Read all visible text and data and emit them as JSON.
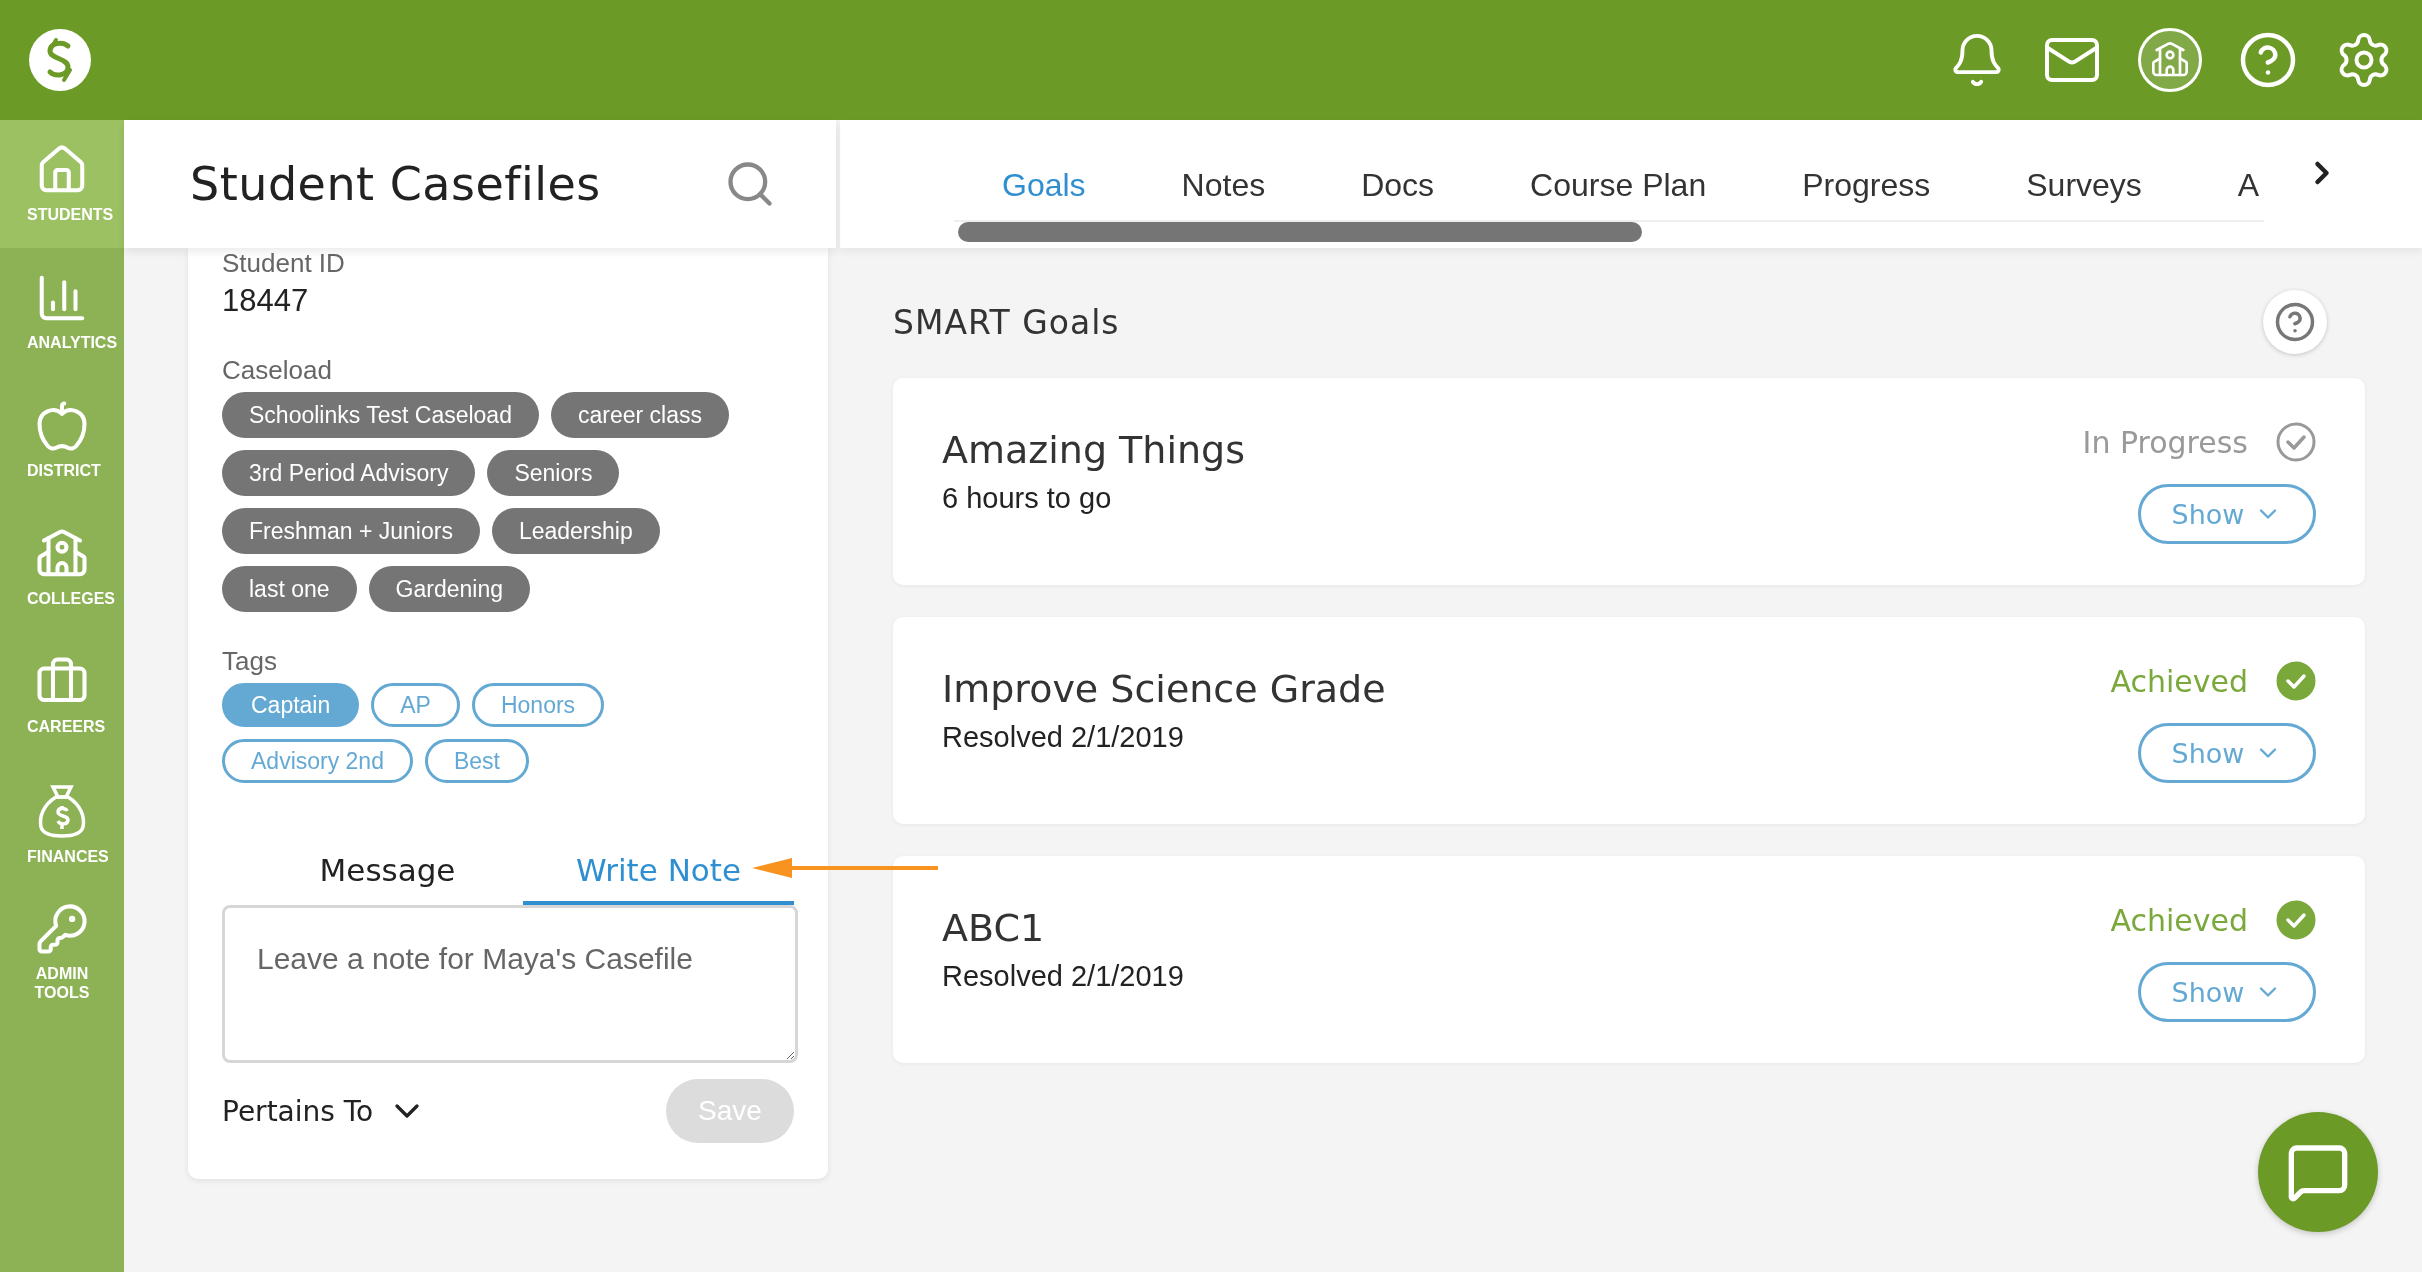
{
  "sidebar": {
    "items": [
      {
        "label": "STUDENTS",
        "selected": true
      },
      {
        "label": "ANALYTICS",
        "selected": false
      },
      {
        "label": "DISTRICT",
        "selected": false
      },
      {
        "label": "COLLEGES",
        "selected": false
      },
      {
        "label": "CAREERS",
        "selected": false
      },
      {
        "label": "FINANCES",
        "selected": false
      },
      {
        "label": "ADMIN TOOLS",
        "selected": false
      }
    ]
  },
  "casefile": {
    "title": "Student Casefiles",
    "student_id_label": "Student ID",
    "student_id": "18447",
    "caseload_label": "Caseload",
    "caseload": [
      "Schoolinks Test Caseload",
      "career class",
      "3rd Period Advisory",
      "Seniors",
      "Freshman + Juniors",
      "Leadership",
      "last one",
      "Gardening"
    ],
    "tags_label": "Tags",
    "tags": [
      {
        "label": "Captain",
        "selected": true
      },
      {
        "label": "AP",
        "selected": false
      },
      {
        "label": "Honors",
        "selected": false
      },
      {
        "label": "Advisory 2nd",
        "selected": false
      },
      {
        "label": "Best",
        "selected": false
      }
    ],
    "note_tabs": [
      {
        "label": "Message",
        "selected": false
      },
      {
        "label": "Write Note",
        "selected": true
      }
    ],
    "note": {
      "placeholder": "Leave a note for Maya's Casefile"
    },
    "pertains_to": "Pertains To",
    "save": {
      "label": "Save",
      "disabled": true
    }
  },
  "tabs": [
    {
      "label": "Goals",
      "selected": true
    },
    {
      "label": "Notes",
      "selected": false
    },
    {
      "label": "Docs",
      "selected": false
    },
    {
      "label": "Course Plan",
      "selected": false
    },
    {
      "label": "Progress",
      "selected": false
    },
    {
      "label": "Surveys",
      "selected": false
    },
    {
      "label": "A",
      "selected": false
    }
  ],
  "goals": {
    "title": "SMART Goals",
    "items": [
      {
        "title": "Amazing Things",
        "detail": "6 hours to go",
        "status": "In Progress",
        "kind": "progress",
        "button": "Show"
      },
      {
        "title": "Improve Science Grade",
        "detail": "Resolved 2/1/2019",
        "status": "Achieved",
        "kind": "achieved",
        "button": "Show"
      },
      {
        "title": "ABC1",
        "detail": "Resolved 2/1/2019",
        "status": "Achieved",
        "kind": "achieved",
        "button": "Show"
      }
    ]
  }
}
